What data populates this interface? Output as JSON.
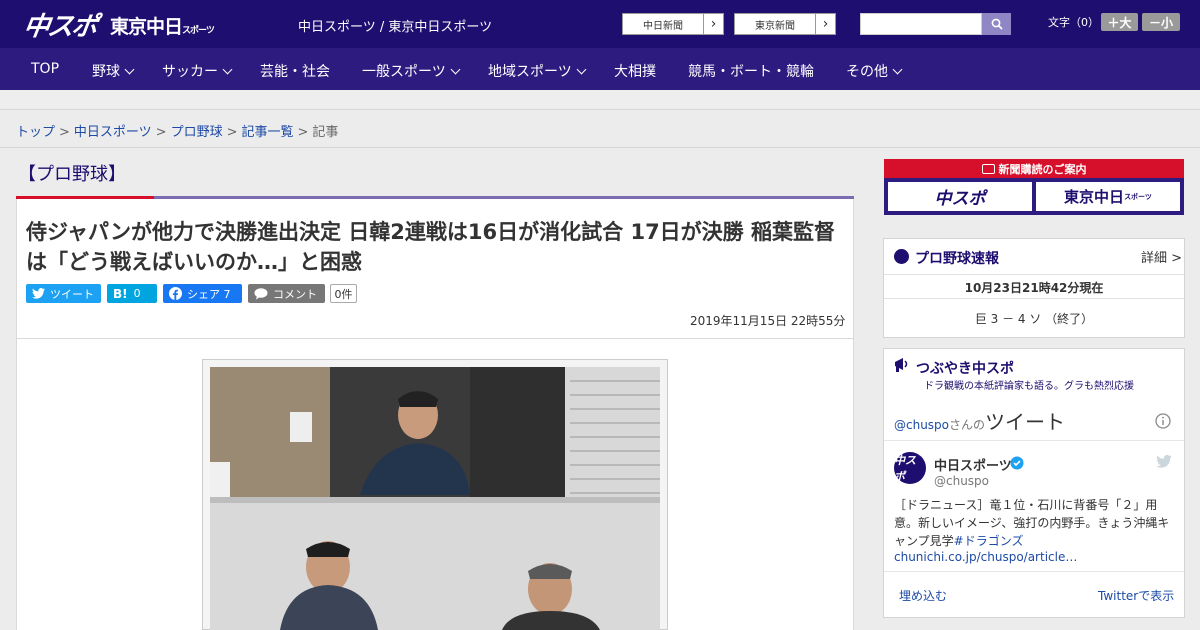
{
  "header": {
    "logo_main": "中スポ",
    "logo_tokyo": "東京中日",
    "logo_tokyo_small": "スポーツ",
    "site_title": "中日スポーツ / 東京中日スポーツ",
    "ext_link_1": "中日新聞",
    "ext_link_2": "東京新聞",
    "search_placeholder": "",
    "font_size_label": "文字（0）",
    "font_up": "＋大",
    "font_down": "－小"
  },
  "nav": {
    "items": [
      {
        "label": "TOP",
        "dropdown": false
      },
      {
        "label": "野球",
        "dropdown": true
      },
      {
        "label": "サッカー",
        "dropdown": true
      },
      {
        "label": "芸能・社会",
        "dropdown": false
      },
      {
        "label": "一般スポーツ",
        "dropdown": true
      },
      {
        "label": "地域スポーツ",
        "dropdown": true
      },
      {
        "label": "大相撲",
        "dropdown": false
      },
      {
        "label": "競馬・ボート・競輪",
        "dropdown": false
      },
      {
        "label": "その他",
        "dropdown": true
      }
    ]
  },
  "breadcrumb": {
    "items": [
      "トップ",
      "中日スポーツ",
      "プロ野球",
      "記事一覧"
    ],
    "current": "記事",
    "separator": ">"
  },
  "article": {
    "category": "【プロ野球】",
    "headline": "侍ジャパンが他力で決勝進出決定 日韓2連戦は16日が消化試合 17日が決勝 稲葉監督は「どう戦えばいいのか…」と困惑",
    "share": {
      "tweet_label": "ツイート",
      "hatena_label": "0",
      "facebook_label": "シェア 7",
      "comment_label": "コメント",
      "comment_count": "0件"
    },
    "date": "2019年11月15日 22時55分"
  },
  "sidebar": {
    "subscription": {
      "title": "新聞購読のご案内",
      "logo_1": "中スポ",
      "logo_2": "東京中日",
      "logo_2_small": "スポーツ"
    },
    "baseball": {
      "title": "プロ野球速報",
      "detail": "詳細 >",
      "as_of": "10月23日21時42分現在",
      "score": "巨 3 － 4 ソ （終了）"
    },
    "tweets": {
      "title": "つぶやき中スポ",
      "subtitle": "ドラ観戦の本紙評論家も語る。グラも熱烈応援",
      "handle_prefix": "@chuspo",
      "handle_suffix": "さんの",
      "tweets_word": "ツイート",
      "account_name": "中日スポーツ",
      "account_handle": "@chuspo",
      "tweet_text": "［ドラニュース］竜１位・石川に背番号「２」用意。新しいイメージ、強打の内野手。きょう沖縄キャンプ見学",
      "tweet_hashtag": "#ドラゴンズ",
      "tweet_link": "chunichi.co.jp/chuspo/article…",
      "embed": "埋め込む",
      "view_on_twitter": "Twitterで表示"
    }
  },
  "colors": {
    "header_bg": "#1e0e6f",
    "nav_bg": "#2d1b80",
    "accent_red": "#d6102a",
    "link_blue": "#1d4aa6",
    "twitter_blue": "#1da1f2",
    "hatena_blue": "#00a4de",
    "facebook_blue": "#1877f2"
  }
}
